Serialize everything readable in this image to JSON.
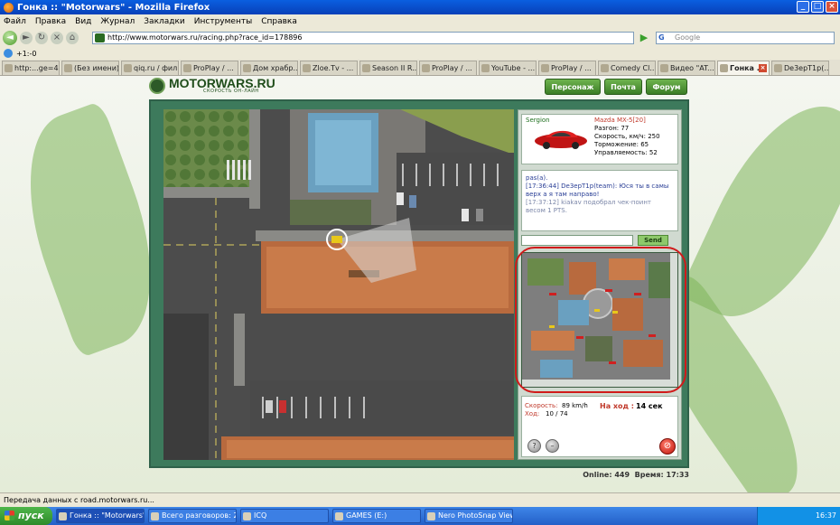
{
  "window": {
    "title": "Гонка :: \"Motorwars\" - Mozilla Firefox"
  },
  "menu": [
    "Файл",
    "Правка",
    "Вид",
    "Журнал",
    "Закладки",
    "Инструменты",
    "Справка"
  ],
  "nav": {
    "url": "http://www.motorwars.ru/racing.php?race_id=178896",
    "search_placeholder": "Google",
    "toolbar_text": "+1:-0"
  },
  "tabs": [
    {
      "label": "http:...ge=43"
    },
    {
      "label": "(Без имени)"
    },
    {
      "label": "qiq.ru / фил..."
    },
    {
      "label": "ProPlay / ..."
    },
    {
      "label": "Дом храбр..."
    },
    {
      "label": "Zloe.Tv - ..."
    },
    {
      "label": "Season II R..."
    },
    {
      "label": "ProPlay / ..."
    },
    {
      "label": "YouTube - ..."
    },
    {
      "label": "ProPlay / ..."
    },
    {
      "label": "Comedy Cl..."
    },
    {
      "label": "Видео \"AT..."
    },
    {
      "label": "Гонка ..."
    },
    {
      "label": "De3epT1p(..."
    }
  ],
  "site": {
    "logo": "MOTORWARS.RU",
    "slogan": "СКОРОСТЬ ОН-ЛАЙН",
    "buttons": {
      "character": "Персонаж",
      "mail": "Почта",
      "forum": "Форум"
    }
  },
  "player": {
    "name": "Sergion",
    "car": "Mazda MX-5[20]",
    "stats": [
      "Разгон: 77",
      "Скорость, км/ч: 250",
      "Торможение: 65",
      "Управляемость: 52"
    ],
    "car_color": "#d01818"
  },
  "chat": {
    "lines": [
      {
        "text": "pas(a).",
        "sys": false
      },
      {
        "text": "[17:36:44] De3epT1p(team): Юся ты в самы верх а я там направо!",
        "sys": false
      },
      {
        "text": "[17:37:12] kiakav подобрал чек-поинт весом 1 PTS.",
        "sys": true
      }
    ],
    "send_label": "Send"
  },
  "race": {
    "speed_label": "Скорость:",
    "speed_value": "89 km/h",
    "move_label": "Ход:",
    "move_value": "10 / 74",
    "turn_label": "На ход :",
    "turn_value": "14 сек"
  },
  "footer": {
    "online": "Online: 449",
    "time": "Время: 17:33"
  },
  "status": "Передача данных с road.motorwars.ru...",
  "taskbar": {
    "start": "пуск",
    "items": [
      "Гонка :: \"Motorwars\" - ...",
      "Всего разговоров: 2 - ...",
      "ICQ",
      "GAMES (E:)",
      "Nero PhotoSnap Viewer"
    ],
    "clock": "16:37"
  }
}
